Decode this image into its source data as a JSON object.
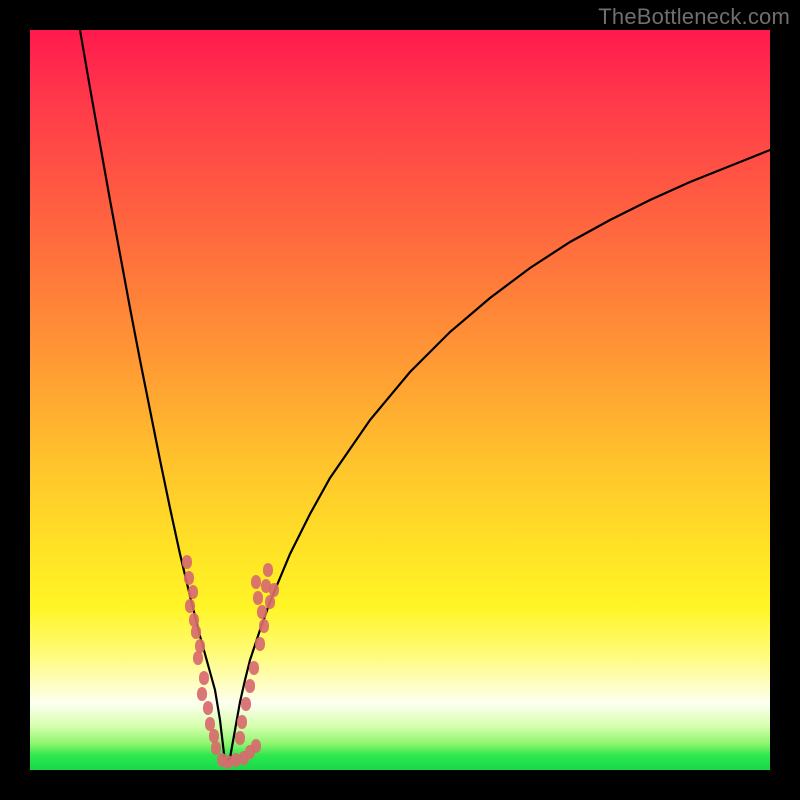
{
  "watermark": {
    "text": "TheBottleneck.com"
  },
  "colors": {
    "frame": "#000000",
    "curve_stroke": "#000000",
    "marker_fill": "#d86a6e",
    "marker_fill_alt": "#d07072",
    "gradient_stops": [
      "#ff1a4d",
      "#ff3a4a",
      "#ff6a3e",
      "#ff9a34",
      "#ffc22c",
      "#ffe226",
      "#fff526",
      "#fffb74",
      "#fdfff0",
      "#d8ffb0",
      "#8cf56c",
      "#2ee84e",
      "#18d94a"
    ]
  },
  "chart_data": {
    "type": "line",
    "title": "",
    "xlabel": "",
    "ylabel": "",
    "xlim": [
      0,
      740
    ],
    "ylim_inverted_pixels": [
      0,
      740
    ],
    "annotations": [
      "TheBottleneck.com"
    ],
    "description": "V-shaped bottleneck curve over performance-band gradient background; curve reaches minimum near x≈195, y≈732; scattered coral markers cluster along both sides of the notch between y≈530 and y≈740.",
    "series": [
      {
        "name": "bottleneck-curve",
        "x": [
          50,
          60,
          70,
          80,
          90,
          100,
          110,
          120,
          130,
          140,
          150,
          160,
          170,
          175,
          180,
          185,
          190,
          195,
          200,
          205,
          210,
          215,
          220,
          230,
          240,
          260,
          280,
          300,
          340,
          380,
          420,
          460,
          500,
          540,
          580,
          620,
          660,
          700,
          740
        ],
        "y": [
          0,
          58,
          114,
          170,
          224,
          278,
          330,
          380,
          430,
          478,
          524,
          566,
          606,
          624,
          642,
          660,
          690,
          732,
          728,
          700,
          672,
          650,
          630,
          600,
          572,
          524,
          484,
          448,
          390,
          342,
          302,
          268,
          238,
          212,
          190,
          170,
          152,
          136,
          120
        ]
      }
    ],
    "markers": [
      {
        "x": 157,
        "y": 532
      },
      {
        "x": 159,
        "y": 548
      },
      {
        "x": 163,
        "y": 562
      },
      {
        "x": 160,
        "y": 576
      },
      {
        "x": 164,
        "y": 590
      },
      {
        "x": 166,
        "y": 602
      },
      {
        "x": 170,
        "y": 616
      },
      {
        "x": 168,
        "y": 628
      },
      {
        "x": 174,
        "y": 648
      },
      {
        "x": 172,
        "y": 664
      },
      {
        "x": 178,
        "y": 678
      },
      {
        "x": 180,
        "y": 694
      },
      {
        "x": 184,
        "y": 706
      },
      {
        "x": 186,
        "y": 718
      },
      {
        "x": 192,
        "y": 730
      },
      {
        "x": 198,
        "y": 732
      },
      {
        "x": 206,
        "y": 730
      },
      {
        "x": 214,
        "y": 728
      },
      {
        "x": 220,
        "y": 722
      },
      {
        "x": 226,
        "y": 716
      },
      {
        "x": 210,
        "y": 708
      },
      {
        "x": 212,
        "y": 692
      },
      {
        "x": 216,
        "y": 674
      },
      {
        "x": 220,
        "y": 656
      },
      {
        "x": 224,
        "y": 638
      },
      {
        "x": 230,
        "y": 614
      },
      {
        "x": 234,
        "y": 596
      },
      {
        "x": 232,
        "y": 582
      },
      {
        "x": 228,
        "y": 568
      },
      {
        "x": 226,
        "y": 552
      },
      {
        "x": 238,
        "y": 540
      },
      {
        "x": 236,
        "y": 556
      },
      {
        "x": 240,
        "y": 572
      },
      {
        "x": 244,
        "y": 560
      }
    ]
  }
}
